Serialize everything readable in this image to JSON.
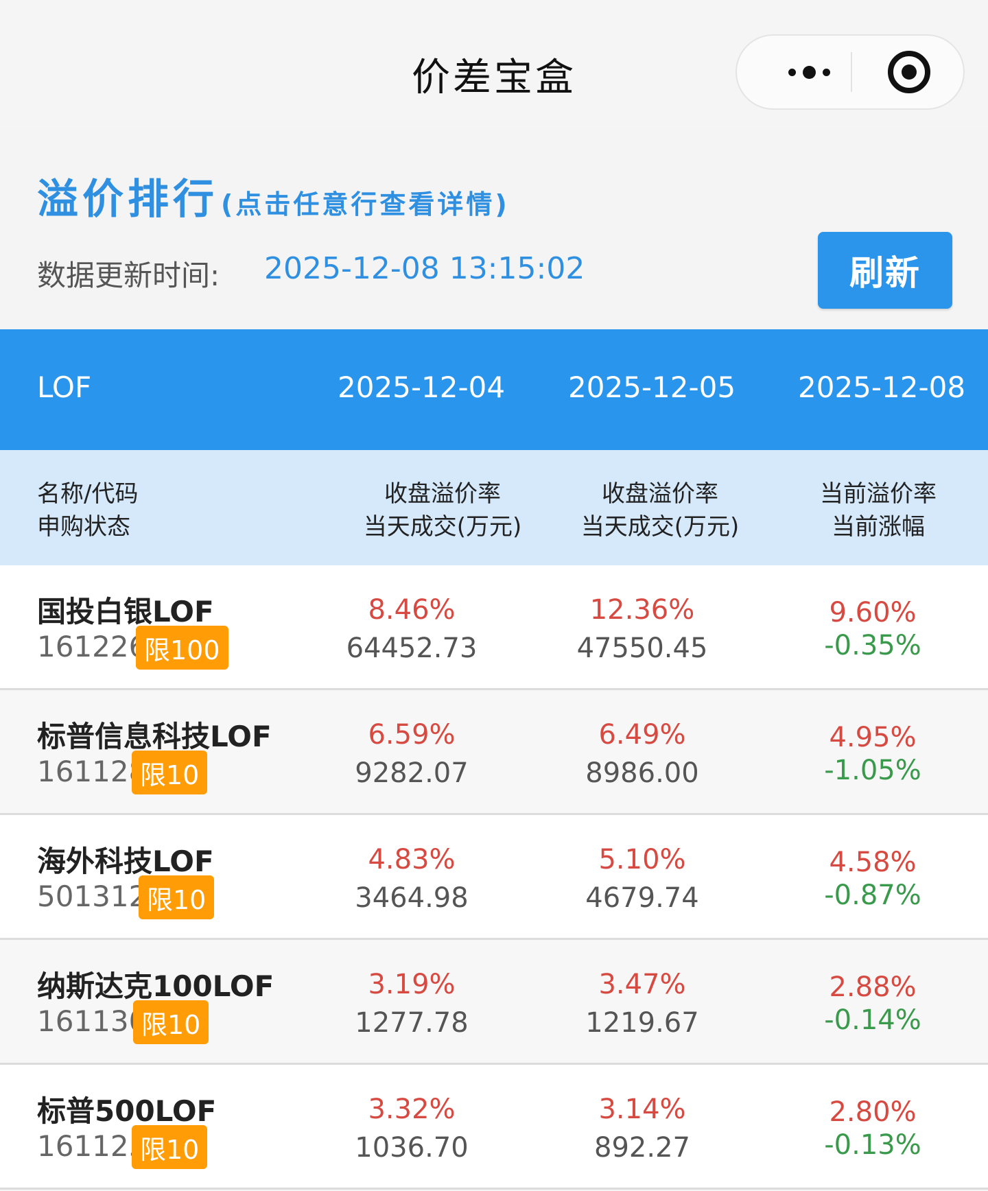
{
  "nav": {
    "title": "价差宝盒"
  },
  "header": {
    "title": "溢价排行",
    "subtitle": "(点击任意行查看详情)",
    "update_label": "数据更新时间:",
    "update_time": "2025-12-08 13:15:02",
    "refresh_label": "刷新"
  },
  "table": {
    "group": "LOF",
    "dates": [
      "2025-12-04",
      "2025-12-05",
      "2025-12-08"
    ],
    "col0": [
      "名称/代码",
      "申购状态"
    ],
    "col1": [
      "收盘溢价率",
      "当天成交(万元)"
    ],
    "col2": [
      "收盘溢价率",
      "当天成交(万元)"
    ],
    "col3": [
      "当前溢价率",
      "当前涨幅"
    ],
    "rows": [
      {
        "name": "国投白银LOF",
        "code": "161226",
        "status": "限100",
        "d1_premium": "8.46%",
        "d1_volume": "64452.73",
        "d2_premium": "12.36%",
        "d2_volume": "47550.45",
        "cur_premium": "9.60%",
        "cur_change": "-0.35%"
      },
      {
        "name": "标普信息科技LOF",
        "code": "161128",
        "status": "限10",
        "d1_premium": "6.59%",
        "d1_volume": "9282.07",
        "d2_premium": "6.49%",
        "d2_volume": "8986.00",
        "cur_premium": "4.95%",
        "cur_change": "-1.05%"
      },
      {
        "name": "海外科技LOF",
        "code": "501312",
        "status": "限10",
        "d1_premium": "4.83%",
        "d1_volume": "3464.98",
        "d2_premium": "5.10%",
        "d2_volume": "4679.74",
        "cur_premium": "4.58%",
        "cur_change": "-0.87%"
      },
      {
        "name": "纳斯达克100LOF",
        "code": "161130",
        "status": "限10",
        "d1_premium": "3.19%",
        "d1_volume": "1277.78",
        "d2_premium": "3.47%",
        "d2_volume": "1219.67",
        "cur_premium": "2.88%",
        "cur_change": "-0.14%"
      },
      {
        "name": "标普500LOF",
        "code": "161125",
        "status": "限10",
        "d1_premium": "3.32%",
        "d1_volume": "1036.70",
        "d2_premium": "3.14%",
        "d2_volume": "892.27",
        "cur_premium": "2.80%",
        "cur_change": "-0.13%"
      }
    ]
  },
  "colors": {
    "accent": "#2a95ec",
    "subheader_bg": "#d5e9fb",
    "premium_red": "#d64a42",
    "change_green": "#3a9a4c",
    "badge_orange": "#ff9c06"
  },
  "icons": {
    "more": "more-dots-icon",
    "close": "mini-program-close-icon"
  }
}
